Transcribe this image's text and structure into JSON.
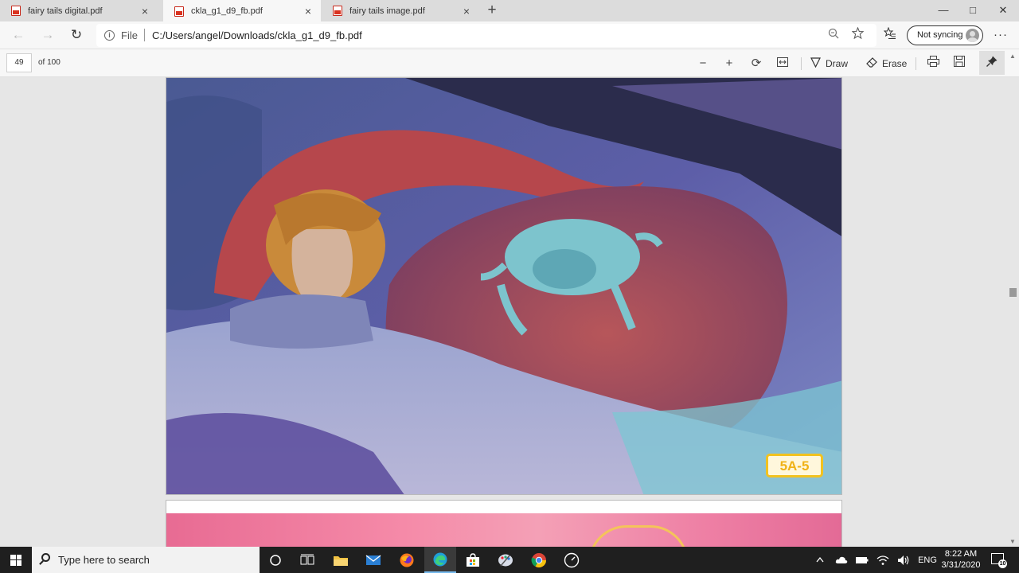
{
  "tabs": [
    {
      "title": "fairy tails digital.pdf",
      "close": "×"
    },
    {
      "title": "ckla_g1_d9_fb.pdf",
      "close": "×"
    },
    {
      "title": "fairy tails image.pdf",
      "close": "×"
    }
  ],
  "window": {
    "new_tab": "+",
    "minimize": "—",
    "maximize": "□",
    "close": "✕"
  },
  "address": {
    "back": "←",
    "forward": "→",
    "refresh": "↻",
    "scheme_label": "File",
    "url": "C:/Users/angel/Downloads/ckla_g1_d9_fb.pdf",
    "zoom_icon": "zoom-icon",
    "favorite_icon": "star-icon",
    "collections_icon": "favorites-list-icon",
    "sync_label": "Not syncing",
    "more": "···"
  },
  "pdf_toolbar": {
    "page_number": "49",
    "page_count": "of 100",
    "zoom_out": "−",
    "zoom_in": "+",
    "rotate": "⟳",
    "fit": "⇔",
    "draw_label": "Draw",
    "erase_label": "Erase",
    "print": "⎙",
    "save": "💾",
    "pin": "📌"
  },
  "document": {
    "card_label": "5A-5"
  },
  "taskbar": {
    "search_placeholder": "Type here to search",
    "tray_lang": "ENG",
    "time": "8:22 AM",
    "date": "3/31/2020",
    "notification_count": "10"
  },
  "colors": {
    "accent": "#76b9ed",
    "card_border": "#f2c21f",
    "pdf_red": "#d9321f"
  }
}
